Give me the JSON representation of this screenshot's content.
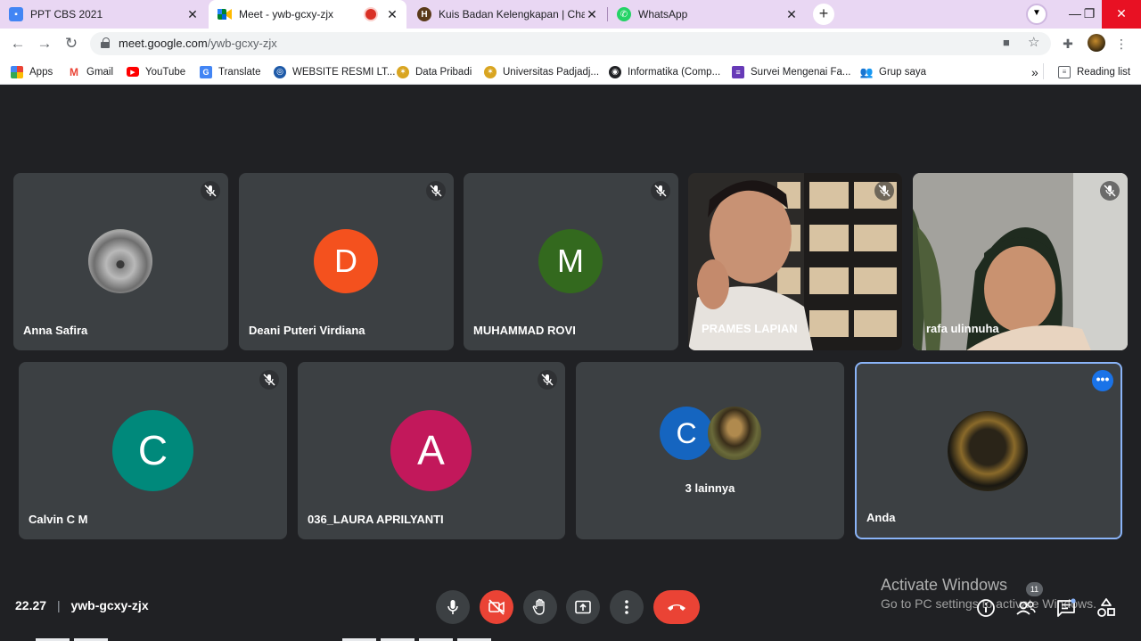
{
  "browser": {
    "tabs": [
      {
        "title": "PPT CBS 2021",
        "icon": "slides-icon",
        "color": "#4285f4"
      },
      {
        "title": "Meet - ywb-gcxy-zjx",
        "icon": "meet-icon",
        "color": "#00897b",
        "recording": true
      },
      {
        "title": "Kuis Badan Kelengkapan | Charac",
        "icon": "kuis-icon",
        "color": "#5a3a1a"
      },
      {
        "title": "WhatsApp",
        "icon": "whatsapp-icon",
        "color": "#25d366"
      }
    ],
    "url_host": "meet.google.com",
    "url_path": "/ywb-gcxy-zjx",
    "bookmarks": [
      "Apps",
      "Gmail",
      "YouTube",
      "Translate",
      "WEBSITE RESMI LT...",
      "Data Pribadi",
      "Universitas Padjadj...",
      "Informatika (Comp...",
      "Survei Mengenai Fa...",
      "Grup saya"
    ],
    "more_bookmarks": "»",
    "reading_list": "Reading list"
  },
  "meet": {
    "participants_row1": [
      {
        "name": "Anna Safira",
        "avatar": "koala-photo",
        "muted": true
      },
      {
        "name": "Deani Puteri Virdiana",
        "initial": "D",
        "color": "#f4511e",
        "muted": true
      },
      {
        "name": "MUHAMMAD ROVI",
        "initial": "M",
        "color": "#33691e",
        "muted": true
      },
      {
        "name": "PRAMES LAPIAN",
        "video": true,
        "muted": true
      },
      {
        "name": "rafa ulinnuha",
        "video": true,
        "muted": true
      }
    ],
    "participants_row2": [
      {
        "name": "Calvin C M",
        "initial": "C",
        "color": "#00897b",
        "muted": true
      },
      {
        "name": "036_LAURA APRILYANTI",
        "initial": "A",
        "color": "#c2185b",
        "muted": true
      },
      {
        "name": "",
        "initial": "C",
        "color": "#1565c0",
        "others_label": "3 lainnya"
      },
      {
        "name": "Anda",
        "avatar": "self-photo",
        "self": true
      }
    ],
    "time": "22.27",
    "meeting_code": "ywb-gcxy-zjx",
    "participant_count": "11",
    "colors": {
      "background": "#202124",
      "tile": "#3c4043",
      "danger": "#ea4335",
      "accent": "#1a73e8"
    }
  },
  "watermark": {
    "line1": "Activate Windows",
    "line2": "Go to PC settings to activate Windows."
  }
}
